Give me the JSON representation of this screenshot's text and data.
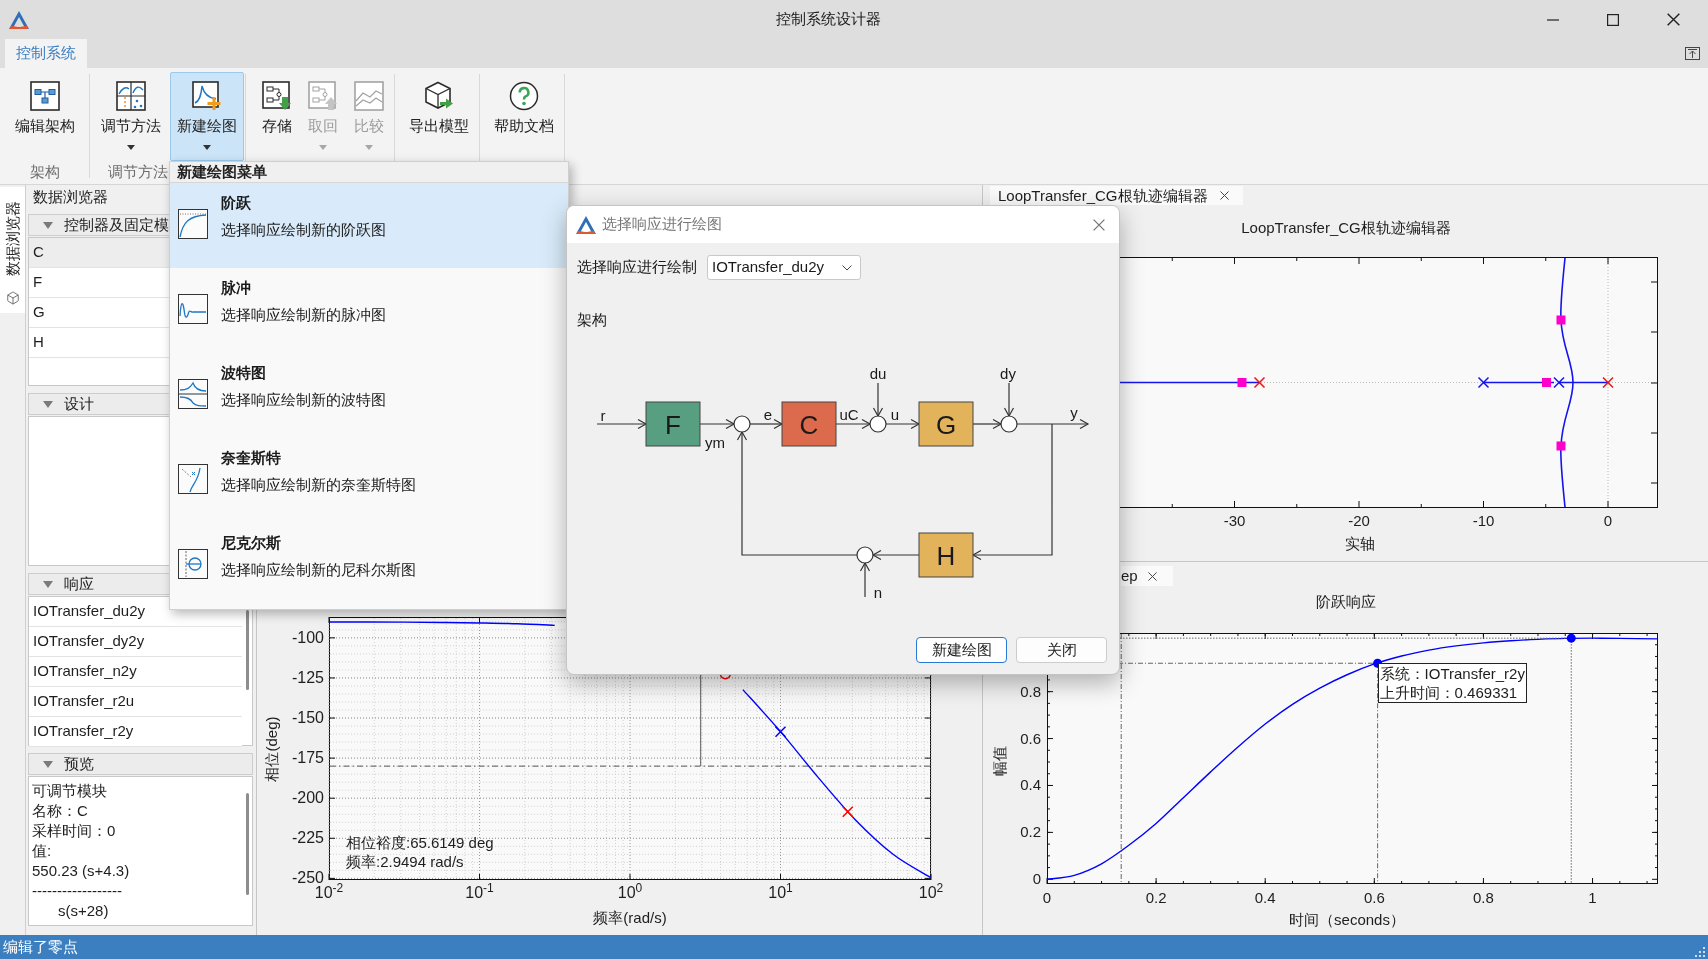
{
  "window": {
    "title": "控制系统设计器"
  },
  "ribbon_tabs": [
    {
      "label": "控制系统",
      "selected": true
    }
  ],
  "ribbon": {
    "groups": [
      {
        "label": "架构",
        "buttons": [
          {
            "label": "编辑架构",
            "active": false,
            "disabled": false,
            "dropdown": false
          }
        ]
      },
      {
        "label": "调节方法",
        "buttons": [
          {
            "label": "调节方法",
            "active": false,
            "disabled": false,
            "dropdown": true
          },
          {
            "label": "新建绘图",
            "active": true,
            "disabled": false,
            "dropdown": true
          }
        ]
      },
      {
        "buttons": [
          {
            "label": "存储",
            "active": false,
            "disabled": false,
            "dropdown": false
          },
          {
            "label": "取回",
            "active": false,
            "disabled": true,
            "dropdown": true
          },
          {
            "label": "比较",
            "active": false,
            "disabled": true,
            "dropdown": true
          }
        ]
      },
      {
        "buttons": [
          {
            "label": "导出模型",
            "active": false,
            "disabled": false,
            "dropdown": false
          }
        ]
      },
      {
        "buttons": [
          {
            "label": "帮助文档",
            "active": false,
            "disabled": false,
            "dropdown": false
          }
        ]
      }
    ]
  },
  "side_tabs": [
    {
      "label": "数据浏览器",
      "selected": true
    }
  ],
  "data_browser": {
    "title": "数据浏览器",
    "sections": [
      {
        "kind": "list",
        "title": "控制器及固定模",
        "expanded": true,
        "items": [
          {
            "label": "C",
            "selected": true
          },
          {
            "label": "F",
            "selected": false
          },
          {
            "label": "G",
            "selected": false
          },
          {
            "label": "H",
            "selected": false
          }
        ]
      },
      {
        "kind": "list",
        "title": "设计",
        "expanded": true
      },
      {
        "kind": "list",
        "title": "响应",
        "expanded": true,
        "items": [
          {
            "label": "IOTransfer_du2y",
            "selected": false
          },
          {
            "label": "IOTransfer_dy2y",
            "selected": false
          },
          {
            "label": "IOTransfer_n2y",
            "selected": false
          },
          {
            "label": "IOTransfer_r2u",
            "selected": false
          },
          {
            "label": "IOTransfer_r2y",
            "selected": false
          }
        ]
      },
      {
        "kind": "preview",
        "title": "预览",
        "expanded": true,
        "lines": [
          "可调节模块",
          "名称：C",
          "采样时间：0",
          "值:"
        ],
        "numerator": "550.23 (s+4.3)",
        "fraction_bar": "------------------",
        "denominator": "s(s+28)"
      }
    ]
  },
  "plot_panels": [
    {
      "kind": "root-locus",
      "tab": {
        "label": "LoopTransfer_CG根轨迹编辑器"
      },
      "title": "LoopTransfer_CG根轨迹编辑器",
      "xtick_labels": [
        "-30",
        "-20",
        "-10",
        "0"
      ],
      "xlabel": "实轴"
    },
    {
      "kind": "bode",
      "chart_data": {
        "type": "line",
        "xlabel": "频率(rad/s)",
        "ylabel": "相位(deg)",
        "categories": [
          "10$^{-2}$",
          null,
          null,
          null,
          "10$^{-1}$",
          null,
          null,
          null,
          "10$^{0}$",
          null,
          null,
          null,
          "10$^{1}$",
          null,
          null,
          null,
          "10$^{2}$"
        ],
        "series": [
          {
            "color": "#0000ff",
            "values": [
              -90.1,
              -90.1,
              -90.2,
              -90.4,
              -90.7,
              -91.2,
              -92.2,
              null,
              null,
              null,
              null,
              -132.3,
              -158.5,
              -187,
              -213.7,
              -235.1,
              -249.6
            ]
          }
        ],
        "ylim": [
          -251,
          -87
        ],
        "yticks": [
          -100,
          -125,
          -150,
          -175,
          -200,
          -225,
          -250
        ],
        "grid": true,
        "ref_lines": [
          {
            "axis": "y",
            "value": -180,
            "color": "#555555"
          }
        ],
        "annotations": [
          "相位裕度:65.6149 deg",
          "频率:2.9494 rad/s"
        ]
      }
    },
    {
      "kind": "step",
      "tab": {
        "label": "ep"
      },
      "chart_data": {
        "type": "line",
        "title": "阶跃响应",
        "xlabel": "时间（seconds）",
        "ylabel": "幅值",
        "x": [
          0,
          0.05,
          0.1,
          0.15,
          0.2,
          0.25,
          0.3,
          0.35,
          0.4,
          0.45,
          0.5,
          0.55,
          0.6,
          0.65,
          0.7,
          0.75,
          0.8,
          0.85,
          0.9,
          0.95,
          1,
          1.05,
          1.12
        ],
        "series": [
          {
            "color": "#0000ff",
            "values": [
              0,
              0.017,
              0.066,
              0.145,
              0.238,
              0.348,
              0.458,
              0.564,
              0.662,
              0.746,
              0.815,
              0.872,
              0.918,
              0.952,
              0.977,
              0.995,
              1.008,
              1.017,
              1.023,
              1.027,
              1.028,
              1.027,
              1.025
            ]
          }
        ],
        "xlim": [
          0,
          1.12
        ],
        "ylim": [
          -0.02,
          1.05
        ],
        "xticks": [
          0,
          0.2,
          0.4,
          0.6,
          0.8,
          1
        ],
        "yticks": [
          0,
          0.2,
          0.4,
          0.6,
          0.8
        ],
        "annotations": [
          {
            "text": "系统：IOTransfer_r2y\n上升时间：0.469331",
            "x": 0.606,
            "y": 0.921
          }
        ]
      }
    }
  ],
  "new_plot_menu": {
    "header": "新建绘图菜单",
    "items": [
      {
        "title": "阶跃",
        "description": "选择响应绘制新的阶跃图",
        "selected": true
      },
      {
        "title": "脉冲",
        "description": "选择响应绘制新的脉冲图",
        "selected": false
      },
      {
        "title": "波特图",
        "description": "选择响应绘制新的波特图",
        "selected": false
      },
      {
        "title": "奈奎斯特",
        "description": "选择响应绘制新的奈奎斯特图",
        "selected": false
      },
      {
        "title": "尼克尔斯",
        "description": "选择响应绘制新的尼科尔斯图",
        "selected": false
      }
    ]
  },
  "dialog": {
    "title": "选择响应进行绘图",
    "response_label": "选择响应进行绘制",
    "response_select": {
      "value": "IOTransfer_du2y"
    },
    "section_label": "架构",
    "diagram": {
      "blocks": [
        {
          "label": "F",
          "color": "#589e80"
        },
        {
          "label": "C",
          "color": "#dc6a4c"
        },
        {
          "label": "G",
          "color": "#e3b35c"
        },
        {
          "label": "H",
          "color": "#e3b35c"
        }
      ],
      "signals": [
        "r",
        "ym",
        "e",
        "uC",
        "du",
        "u",
        "dy",
        "y",
        "n"
      ]
    },
    "buttons": [
      {
        "label": "新建绘图",
        "primary": true
      },
      {
        "label": "关闭",
        "primary": false
      }
    ]
  },
  "status_bar": {
    "text": "编辑了零点"
  }
}
